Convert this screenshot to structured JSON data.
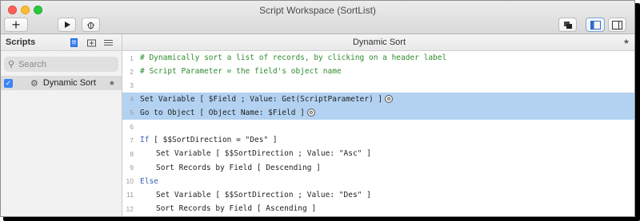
{
  "window": {
    "title": "Script Workspace (SortList)"
  },
  "toolbar": {
    "add_icon": "plus-icon",
    "run_icon": "play-icon",
    "debug_icon": "bug-icon"
  },
  "sidebar": {
    "title": "Scripts",
    "search_placeholder": "Search",
    "items": [
      {
        "label": "Dynamic Sort",
        "checked": true,
        "star": "★"
      }
    ]
  },
  "editor": {
    "tab_title": "Dynamic Sort",
    "star": "★",
    "lines": [
      {
        "n": "1",
        "text": "# Dynamically sort a list of records, by clicking on a header label",
        "type": "comment"
      },
      {
        "n": "2",
        "text": "# Script Parameter = the field's object name",
        "type": "comment"
      },
      {
        "n": "3",
        "text": "",
        "type": "plain"
      },
      {
        "n": "4",
        "text": "Set Variable [ $Field ; Value: Get(ScriptParameter) ]",
        "type": "plain",
        "selected": true,
        "option": true
      },
      {
        "n": "5",
        "text": "Go to Object [ Object Name: $Field ]",
        "type": "plain",
        "selected": true,
        "option": true
      },
      {
        "n": "6",
        "text": "",
        "type": "plain"
      },
      {
        "n": "7",
        "text": "If [ $$SortDirection = \"Des\" ]",
        "type": "keyword"
      },
      {
        "n": "8",
        "text": "Set Variable [ $$SortDirection ; Value: \"Asc\" ]",
        "type": "plain",
        "indent": true
      },
      {
        "n": "9",
        "text": "Sort Records by Field [ Descending ]",
        "type": "plain",
        "indent": true
      },
      {
        "n": "10",
        "text": "Else",
        "type": "keyword"
      },
      {
        "n": "11",
        "text": "Set Variable [ $$SortDirection ; Value: \"Des\" ]",
        "type": "plain",
        "indent": true
      },
      {
        "n": "12",
        "text": "Sort Records by Field [ Ascending ]",
        "type": "plain",
        "indent": true
      }
    ]
  }
}
